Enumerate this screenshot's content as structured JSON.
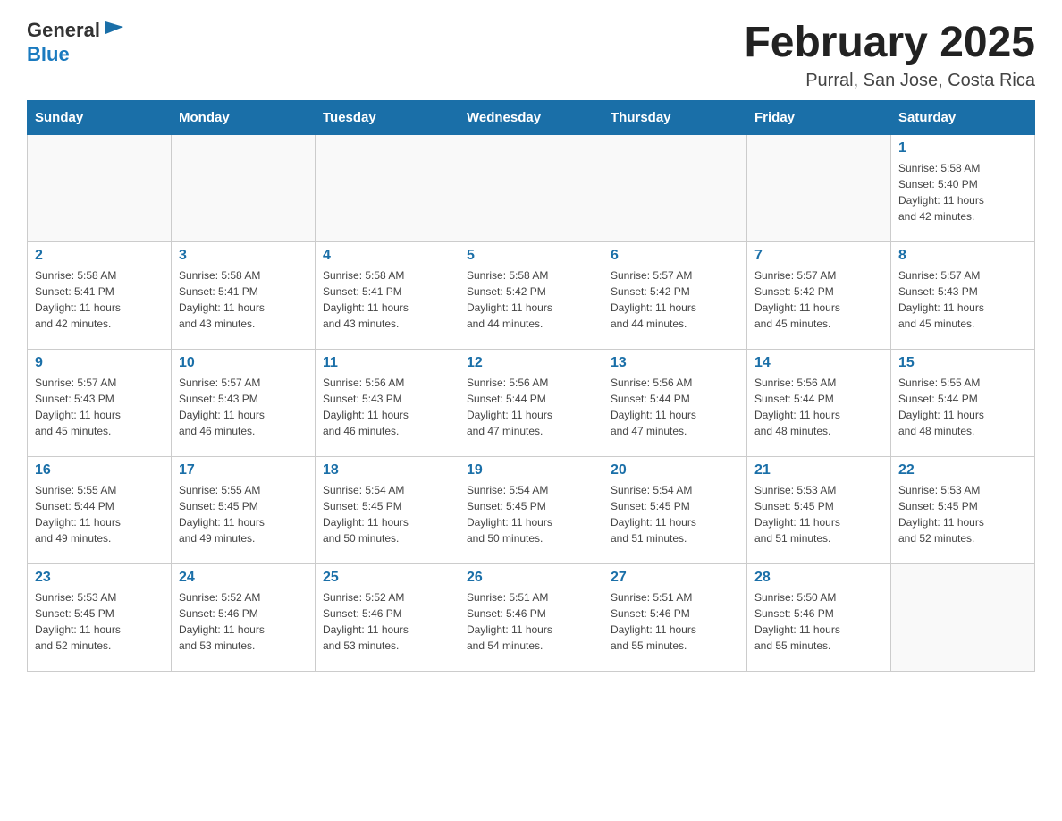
{
  "logo": {
    "general": "General",
    "blue": "Blue"
  },
  "title": "February 2025",
  "location": "Purral, San Jose, Costa Rica",
  "weekdays": [
    "Sunday",
    "Monday",
    "Tuesday",
    "Wednesday",
    "Thursday",
    "Friday",
    "Saturday"
  ],
  "weeks": [
    [
      {
        "day": "",
        "info": ""
      },
      {
        "day": "",
        "info": ""
      },
      {
        "day": "",
        "info": ""
      },
      {
        "day": "",
        "info": ""
      },
      {
        "day": "",
        "info": ""
      },
      {
        "day": "",
        "info": ""
      },
      {
        "day": "1",
        "info": "Sunrise: 5:58 AM\nSunset: 5:40 PM\nDaylight: 11 hours\nand 42 minutes."
      }
    ],
    [
      {
        "day": "2",
        "info": "Sunrise: 5:58 AM\nSunset: 5:41 PM\nDaylight: 11 hours\nand 42 minutes."
      },
      {
        "day": "3",
        "info": "Sunrise: 5:58 AM\nSunset: 5:41 PM\nDaylight: 11 hours\nand 43 minutes."
      },
      {
        "day": "4",
        "info": "Sunrise: 5:58 AM\nSunset: 5:41 PM\nDaylight: 11 hours\nand 43 minutes."
      },
      {
        "day": "5",
        "info": "Sunrise: 5:58 AM\nSunset: 5:42 PM\nDaylight: 11 hours\nand 44 minutes."
      },
      {
        "day": "6",
        "info": "Sunrise: 5:57 AM\nSunset: 5:42 PM\nDaylight: 11 hours\nand 44 minutes."
      },
      {
        "day": "7",
        "info": "Sunrise: 5:57 AM\nSunset: 5:42 PM\nDaylight: 11 hours\nand 45 minutes."
      },
      {
        "day": "8",
        "info": "Sunrise: 5:57 AM\nSunset: 5:43 PM\nDaylight: 11 hours\nand 45 minutes."
      }
    ],
    [
      {
        "day": "9",
        "info": "Sunrise: 5:57 AM\nSunset: 5:43 PM\nDaylight: 11 hours\nand 45 minutes."
      },
      {
        "day": "10",
        "info": "Sunrise: 5:57 AM\nSunset: 5:43 PM\nDaylight: 11 hours\nand 46 minutes."
      },
      {
        "day": "11",
        "info": "Sunrise: 5:56 AM\nSunset: 5:43 PM\nDaylight: 11 hours\nand 46 minutes."
      },
      {
        "day": "12",
        "info": "Sunrise: 5:56 AM\nSunset: 5:44 PM\nDaylight: 11 hours\nand 47 minutes."
      },
      {
        "day": "13",
        "info": "Sunrise: 5:56 AM\nSunset: 5:44 PM\nDaylight: 11 hours\nand 47 minutes."
      },
      {
        "day": "14",
        "info": "Sunrise: 5:56 AM\nSunset: 5:44 PM\nDaylight: 11 hours\nand 48 minutes."
      },
      {
        "day": "15",
        "info": "Sunrise: 5:55 AM\nSunset: 5:44 PM\nDaylight: 11 hours\nand 48 minutes."
      }
    ],
    [
      {
        "day": "16",
        "info": "Sunrise: 5:55 AM\nSunset: 5:44 PM\nDaylight: 11 hours\nand 49 minutes."
      },
      {
        "day": "17",
        "info": "Sunrise: 5:55 AM\nSunset: 5:45 PM\nDaylight: 11 hours\nand 49 minutes."
      },
      {
        "day": "18",
        "info": "Sunrise: 5:54 AM\nSunset: 5:45 PM\nDaylight: 11 hours\nand 50 minutes."
      },
      {
        "day": "19",
        "info": "Sunrise: 5:54 AM\nSunset: 5:45 PM\nDaylight: 11 hours\nand 50 minutes."
      },
      {
        "day": "20",
        "info": "Sunrise: 5:54 AM\nSunset: 5:45 PM\nDaylight: 11 hours\nand 51 minutes."
      },
      {
        "day": "21",
        "info": "Sunrise: 5:53 AM\nSunset: 5:45 PM\nDaylight: 11 hours\nand 51 minutes."
      },
      {
        "day": "22",
        "info": "Sunrise: 5:53 AM\nSunset: 5:45 PM\nDaylight: 11 hours\nand 52 minutes."
      }
    ],
    [
      {
        "day": "23",
        "info": "Sunrise: 5:53 AM\nSunset: 5:45 PM\nDaylight: 11 hours\nand 52 minutes."
      },
      {
        "day": "24",
        "info": "Sunrise: 5:52 AM\nSunset: 5:46 PM\nDaylight: 11 hours\nand 53 minutes."
      },
      {
        "day": "25",
        "info": "Sunrise: 5:52 AM\nSunset: 5:46 PM\nDaylight: 11 hours\nand 53 minutes."
      },
      {
        "day": "26",
        "info": "Sunrise: 5:51 AM\nSunset: 5:46 PM\nDaylight: 11 hours\nand 54 minutes."
      },
      {
        "day": "27",
        "info": "Sunrise: 5:51 AM\nSunset: 5:46 PM\nDaylight: 11 hours\nand 55 minutes."
      },
      {
        "day": "28",
        "info": "Sunrise: 5:50 AM\nSunset: 5:46 PM\nDaylight: 11 hours\nand 55 minutes."
      },
      {
        "day": "",
        "info": ""
      }
    ]
  ]
}
